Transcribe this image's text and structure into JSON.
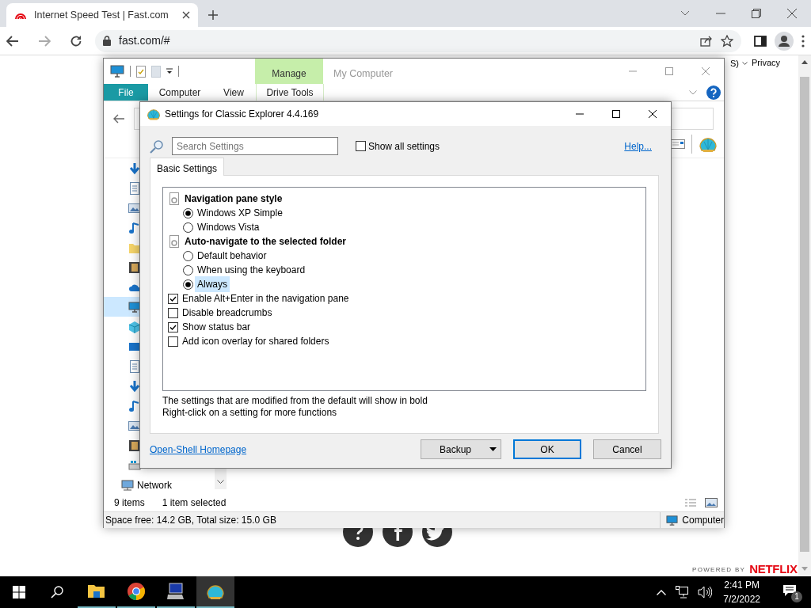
{
  "browser": {
    "tab_title": "Internet Speed Test | Fast.com",
    "url": "fast.com/#"
  },
  "page": {
    "language": "S)",
    "privacy": "Privacy",
    "powered_by": "POWERED BY",
    "brand": "NETFLIX"
  },
  "explorer": {
    "title": "My Computer",
    "context_group": "Manage",
    "ribbon_tabs": [
      {
        "label": "File",
        "kind": "file"
      },
      {
        "label": "Computer",
        "kind": "tab"
      },
      {
        "label": "View",
        "kind": "tab"
      },
      {
        "label": "Drive Tools",
        "kind": "context"
      }
    ],
    "nav_items": [
      {
        "kind": "download",
        "selected": false
      },
      {
        "kind": "document",
        "selected": false
      },
      {
        "kind": "picture",
        "selected": false
      },
      {
        "kind": "music",
        "selected": false
      },
      {
        "kind": "folder",
        "selected": false
      },
      {
        "kind": "film",
        "selected": false
      },
      {
        "kind": "cloud",
        "selected": false
      },
      {
        "kind": "computer",
        "selected": true
      },
      {
        "kind": "cube",
        "selected": false
      },
      {
        "kind": "desktop",
        "selected": false
      },
      {
        "kind": "document",
        "selected": false
      },
      {
        "kind": "download",
        "selected": false
      },
      {
        "kind": "music",
        "selected": false
      },
      {
        "kind": "picture",
        "selected": false
      },
      {
        "kind": "film",
        "selected": false
      },
      {
        "kind": "drive",
        "selected": false
      }
    ],
    "network_label": "Network",
    "item_count": "9 items",
    "selection": "1 item selected",
    "space": "Space free: 14.2 GB, Total size: 15.0 GB",
    "location": "Computer"
  },
  "dialog": {
    "title": "Settings for Classic Explorer 4.4.169",
    "search_placeholder": "Search Settings",
    "show_all": {
      "label": "Show all settings",
      "checked": false
    },
    "help": "Help...",
    "tab": "Basic Settings",
    "items": [
      {
        "kind": "group",
        "label": "Navigation pane style",
        "highlighted": false,
        "children": [
          {
            "kind": "radio",
            "label": "Windows XP Simple",
            "selected": true,
            "highlighted": false
          },
          {
            "kind": "radio",
            "label": "Windows Vista",
            "selected": false,
            "highlighted": false
          }
        ]
      },
      {
        "kind": "group",
        "label": "Auto-navigate to the selected folder",
        "highlighted": false,
        "children": [
          {
            "kind": "radio",
            "label": "Default behavior",
            "selected": false,
            "highlighted": false
          },
          {
            "kind": "radio",
            "label": "When using the keyboard",
            "selected": false,
            "highlighted": false
          },
          {
            "kind": "radio",
            "label": "Always",
            "selected": true,
            "highlighted": true
          }
        ]
      },
      {
        "kind": "checkbox",
        "label": "Enable Alt+Enter in the navigation pane",
        "checked": true,
        "highlighted": false
      },
      {
        "kind": "checkbox",
        "label": "Disable breadcrumbs",
        "checked": false,
        "highlighted": false
      },
      {
        "kind": "checkbox",
        "label": "Show status bar",
        "checked": true,
        "highlighted": false
      },
      {
        "kind": "checkbox",
        "label": "Add icon overlay for shared folders",
        "checked": false,
        "highlighted": false
      }
    ],
    "notes": [
      "The settings that are modified from the default will show in bold",
      "Right-click on a setting for more functions"
    ],
    "homepage_link": "Open-Shell Homepage",
    "buttons": [
      {
        "label": "Backup",
        "kind": "split"
      },
      {
        "label": "OK",
        "kind": "default"
      },
      {
        "label": "Cancel",
        "kind": "normal"
      }
    ]
  },
  "taskbar": {
    "apps": [
      {
        "kind": "folder",
        "selected": false
      },
      {
        "kind": "browser",
        "selected": false
      },
      {
        "kind": "computer",
        "selected": false
      },
      {
        "kind": "shell",
        "selected": true
      }
    ],
    "time": "2:41 PM",
    "date": "7/2/2022",
    "notifications": "1"
  }
}
